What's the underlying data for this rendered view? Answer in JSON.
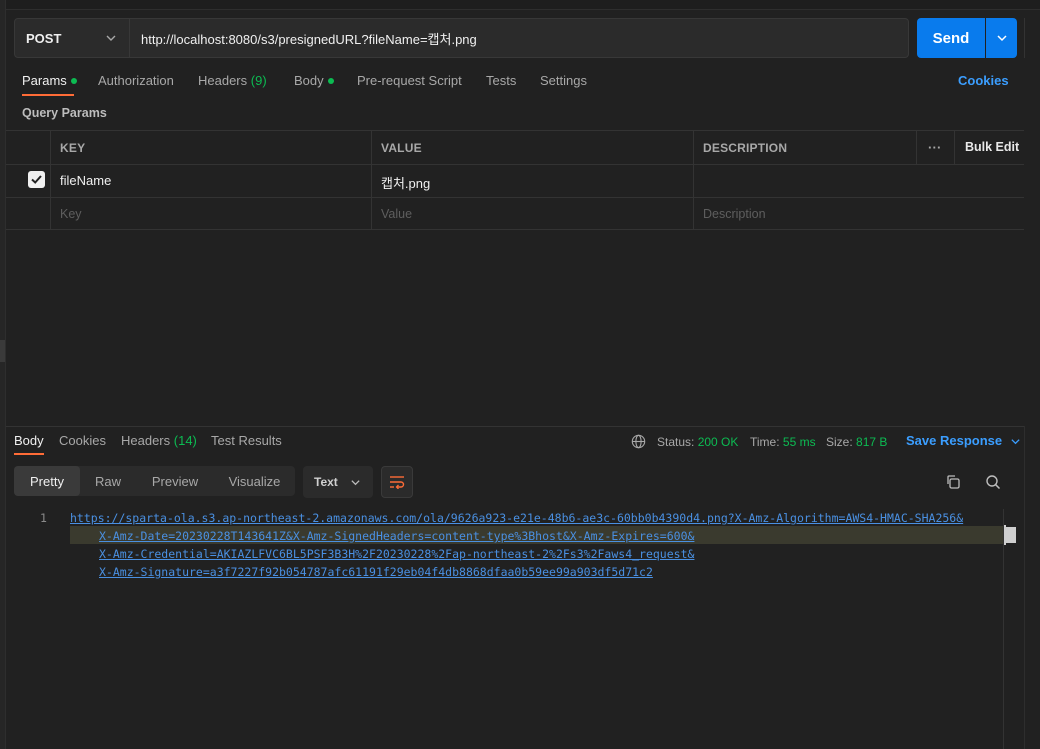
{
  "request": {
    "method": "POST",
    "url": "http://localhost:8080/s3/presignedURL?fileName=캡처.png",
    "send_label": "Send"
  },
  "request_tabs": [
    {
      "label": "Params",
      "dot": true,
      "active": true
    },
    {
      "label": "Authorization"
    },
    {
      "label": "Headers",
      "count": "(9)"
    },
    {
      "label": "Body",
      "dot": true
    },
    {
      "label": "Pre-request Script"
    },
    {
      "label": "Tests"
    },
    {
      "label": "Settings"
    }
  ],
  "cookies_label": "Cookies",
  "query_params_title": "Query Params",
  "params_table": {
    "headers": {
      "key": "KEY",
      "value": "VALUE",
      "description": "DESCRIPTION",
      "more": "···",
      "bulk_edit": "Bulk Edit"
    },
    "rows": [
      {
        "checked": true,
        "key": "fileName",
        "value": "캡처.png",
        "description": ""
      }
    ],
    "placeholders": {
      "key": "Key",
      "value": "Value",
      "description": "Description"
    }
  },
  "response_tabs": [
    {
      "label": "Body",
      "active": true
    },
    {
      "label": "Cookies"
    },
    {
      "label": "Headers",
      "count": "(14)"
    },
    {
      "label": "Test Results"
    }
  ],
  "response_meta": {
    "status_label": "Status:",
    "status_value": "200 OK",
    "time_label": "Time:",
    "time_value": "55 ms",
    "size_label": "Size:",
    "size_value": "817 B",
    "save_label": "Save Response"
  },
  "view_modes": [
    "Pretty",
    "Raw",
    "Preview",
    "Visualize"
  ],
  "format": "Text",
  "code": {
    "line_number": "1",
    "lines": [
      "https://sparta-ola.s3.ap-northeast-2.amazonaws.com/ola/9626a923-e21e-48b6-ae3c-60bb0b4390d4.png?X-Amz-Algorithm=AWS4-HMAC-SHA256&",
      "X-Amz-Date=20230228T143641Z&X-Amz-SignedHeaders=content-type%3Bhost&X-Amz-Expires=600&",
      "X-Amz-Credential=AKIAZLFVC6BL5PSF3B3H%2F20230228%2Fap-northeast-2%2Fs3%2Faws4_request&",
      "X-Amz-Signature=a3f7227f92b054787afc61191f29eb04f4db8868dfaa0b59ee99a903df5d71c2"
    ]
  },
  "colors": {
    "accent": "#ff6c37",
    "send": "#097bed",
    "link": "#3b9eff",
    "success": "#0cbb52"
  },
  "icons": [
    "chevron-down-icon",
    "globe-icon",
    "wrap-lines-icon",
    "copy-icon",
    "search-icon",
    "checkmark-icon"
  ]
}
